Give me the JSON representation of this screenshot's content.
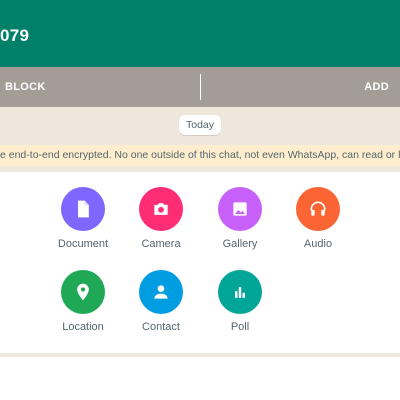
{
  "header": {
    "title": "079"
  },
  "action_bar": {
    "block_label": "BLOCK",
    "add_label": "ADD"
  },
  "chat": {
    "date_chip": "Today",
    "encryption_notice": "e end-to-end encrypted. No one outside of this chat, not even WhatsApp, can read or l"
  },
  "attach_menu": {
    "items": [
      {
        "label": "Document",
        "icon": "document-icon",
        "color": "#7f66ff"
      },
      {
        "label": "Camera",
        "icon": "camera-icon",
        "color": "#ff2e74"
      },
      {
        "label": "Gallery",
        "icon": "gallery-icon",
        "color": "#c861fa"
      },
      {
        "label": "Audio",
        "icon": "headphones-icon",
        "color": "#fa6533"
      },
      {
        "label": "Location",
        "icon": "location-pin-icon",
        "color": "#1fa855"
      },
      {
        "label": "Contact",
        "icon": "contact-icon",
        "color": "#009de2"
      },
      {
        "label": "Poll",
        "icon": "poll-icon",
        "color": "#02a698"
      }
    ]
  },
  "colors": {
    "header": "#008069",
    "action_bar": "#a49d96",
    "chat_background": "#efe7dc",
    "encryption_banner": "#ffeecd"
  }
}
